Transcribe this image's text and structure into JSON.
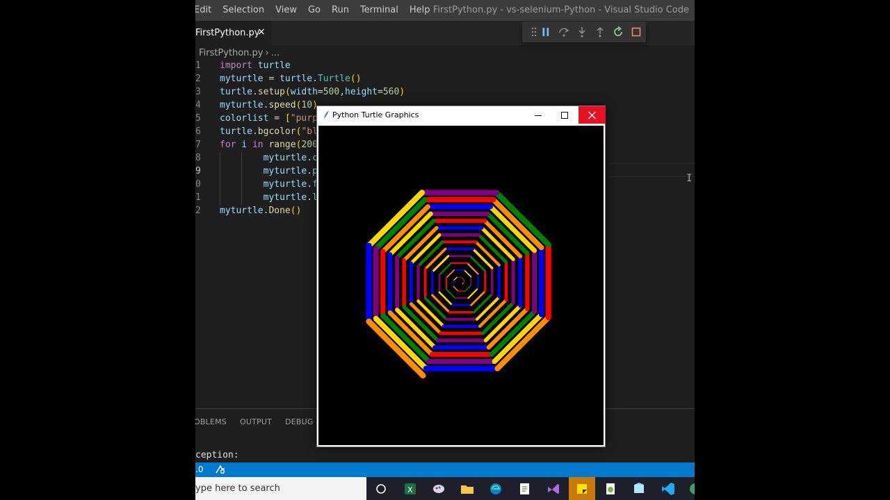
{
  "window": {
    "menu": [
      "Edit",
      "Selection",
      "View",
      "Go",
      "Run",
      "Terminal",
      "Help"
    ],
    "title": "FirstPython.py - vs-selenium-Python - Visual Studio Code"
  },
  "tab": {
    "label": "FirstPython.py",
    "close": "×"
  },
  "breadcrumb": {
    "file": "FirstPython.py",
    "sep": "›",
    "more": "..."
  },
  "debug_toolbar": [
    "drag-handle-icon",
    "pause-icon",
    "step-over-icon",
    "step-into-icon",
    "step-out-icon",
    "restart-icon",
    "stop-icon"
  ],
  "editor": {
    "lines": [
      {
        "n": "1",
        "code": "import turtle"
      },
      {
        "n": "2",
        "code": "myturtle = turtle.Turtle()"
      },
      {
        "n": "3",
        "code": "turtle.setup(width=500,height=560)"
      },
      {
        "n": "4",
        "code": "myturtle.speed(10)"
      },
      {
        "n": "5",
        "code": "colorlist = [\"purp"
      },
      {
        "n": "6",
        "code": "turtle.bgcolor(\"bl"
      },
      {
        "n": "7",
        "code": "for i in range(200"
      },
      {
        "n": "8",
        "code": "        myturtle.c"
      },
      {
        "n": "9",
        "code": "        myturtle.p"
      },
      {
        "n": "0",
        "code": "        myturtle.f"
      },
      {
        "n": "1",
        "code": "        myturtle.l"
      },
      {
        "n": "2",
        "code": "myturtle.Done()"
      }
    ]
  },
  "panel": {
    "tabs": [
      "OBLEMS",
      "OUTPUT",
      "DEBUG C"
    ],
    "terminal_text": "ception:"
  },
  "statusbar": {
    "left": ".0"
  },
  "taskbar": {
    "search_placeholder": "ype here to search",
    "icons": [
      "task-view-icon",
      "excel-icon",
      "paint-icon",
      "file-explorer-icon",
      "edge-icon",
      "notepad-icon",
      "visual-studio-icon",
      "sticky-notes-icon",
      "notepadpp-icon",
      "python-idle-icon",
      "vscode-icon",
      "chrome-icon"
    ]
  },
  "turtle_window": {
    "title": "Python Turtle Graphics",
    "colors": [
      "#0000ff",
      "#ff8c00",
      "#ff0000",
      "#008000",
      "#800080",
      "#ffd700"
    ]
  }
}
